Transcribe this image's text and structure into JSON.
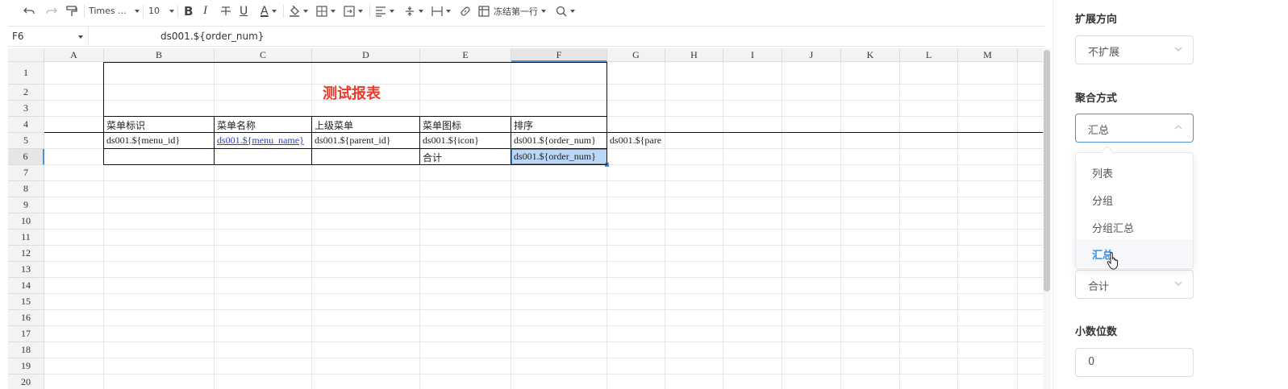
{
  "toolbar": {
    "font_name": "Times ...",
    "font_size": "10",
    "bold": "B",
    "italic": "I",
    "underline": "U",
    "font_color": "A",
    "freeze_label": "冻结第一行"
  },
  "formula_bar": {
    "cell_ref": "F6",
    "formula": "ds001.${order_num}"
  },
  "sheet": {
    "columns": [
      "A",
      "B",
      "C",
      "D",
      "E",
      "F",
      "G",
      "H",
      "I",
      "J",
      "K",
      "L",
      "M"
    ],
    "rows": [
      "1",
      "2",
      "3",
      "4",
      "5",
      "6",
      "7",
      "8",
      "9",
      "10",
      "11",
      "12",
      "13",
      "14",
      "15",
      "16",
      "17",
      "18",
      "19",
      "20"
    ],
    "selected_column": "F",
    "selected_row": "6",
    "title": "测试报表",
    "headers": [
      "菜单标识",
      "菜单名称",
      "上级菜单",
      "菜单图标",
      "排序"
    ],
    "row5": [
      "ds001.${menu_id}",
      "ds001.${menu_name}",
      "ds001.${parent_id}",
      "ds001.${icon}",
      "ds001.${order_num}",
      "ds001.${pare"
    ],
    "row6_label": "合计",
    "row6_value": "ds001.${order_num}"
  },
  "panel": {
    "expand_direction_label": "扩展方向",
    "expand_direction_value": "不扩展",
    "aggregate_label": "聚合方式",
    "aggregate_value": "汇总",
    "options": [
      "列表",
      "分组",
      "分组汇总",
      "汇总"
    ],
    "active_option": "汇总",
    "hidden_select_value": "合计",
    "decimal_label": "小数位数",
    "decimal_value": "0"
  },
  "colors": {
    "title": "#e8392a",
    "accent": "#4a90d9",
    "link": "#2d3fb5",
    "selection_fill": "#bcd6f5"
  }
}
